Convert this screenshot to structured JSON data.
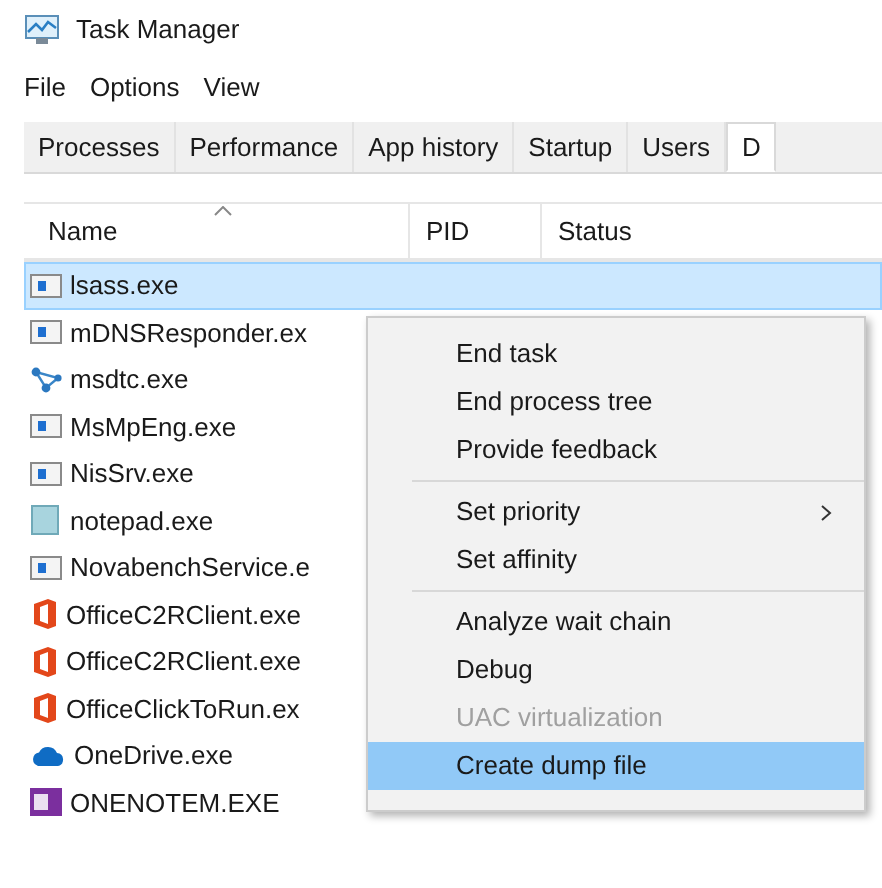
{
  "window": {
    "title": "Task Manager"
  },
  "menubar": [
    "File",
    "Options",
    "View"
  ],
  "tabs": [
    {
      "label": "Processes",
      "selected": false
    },
    {
      "label": "Performance",
      "selected": false
    },
    {
      "label": "App history",
      "selected": false
    },
    {
      "label": "Startup",
      "selected": false
    },
    {
      "label": "Users",
      "selected": false
    },
    {
      "label": "D",
      "selected": true
    }
  ],
  "table": {
    "columns": [
      "Name",
      "PID",
      "Status"
    ],
    "rows": [
      {
        "name": "lsass.exe",
        "kind": "service",
        "selected": true
      },
      {
        "name": "mDNSResponder.ex",
        "kind": "service",
        "selected": false
      },
      {
        "name": "msdtc.exe",
        "kind": "network",
        "selected": false
      },
      {
        "name": "MsMpEng.exe",
        "kind": "service",
        "selected": false
      },
      {
        "name": "NisSrv.exe",
        "kind": "service",
        "selected": false
      },
      {
        "name": "notepad.exe",
        "kind": "notepad",
        "selected": false
      },
      {
        "name": "NovabenchService.e",
        "kind": "service",
        "selected": false
      },
      {
        "name": "OfficeC2RClient.exe",
        "kind": "office",
        "selected": false
      },
      {
        "name": "OfficeC2RClient.exe",
        "kind": "office",
        "selected": false
      },
      {
        "name": "OfficeClickToRun.ex",
        "kind": "office",
        "selected": false
      },
      {
        "name": "OneDrive.exe",
        "kind": "cloud",
        "selected": false
      },
      {
        "name": "ONENOTEM.EXE",
        "kind": "onenote",
        "selected": false
      }
    ]
  },
  "context_menu": {
    "groups": [
      [
        {
          "label": "End task",
          "disabled": false,
          "submenu": false,
          "selected": false
        },
        {
          "label": "End process tree",
          "disabled": false,
          "submenu": false,
          "selected": false
        },
        {
          "label": "Provide feedback",
          "disabled": false,
          "submenu": false,
          "selected": false
        }
      ],
      [
        {
          "label": "Set priority",
          "disabled": false,
          "submenu": true,
          "selected": false
        },
        {
          "label": "Set affinity",
          "disabled": false,
          "submenu": false,
          "selected": false
        }
      ],
      [
        {
          "label": "Analyze wait chain",
          "disabled": false,
          "submenu": false,
          "selected": false
        },
        {
          "label": "Debug",
          "disabled": false,
          "submenu": false,
          "selected": false
        },
        {
          "label": "UAC virtualization",
          "disabled": true,
          "submenu": false,
          "selected": false
        },
        {
          "label": "Create dump file",
          "disabled": false,
          "submenu": false,
          "selected": true
        }
      ]
    ]
  }
}
